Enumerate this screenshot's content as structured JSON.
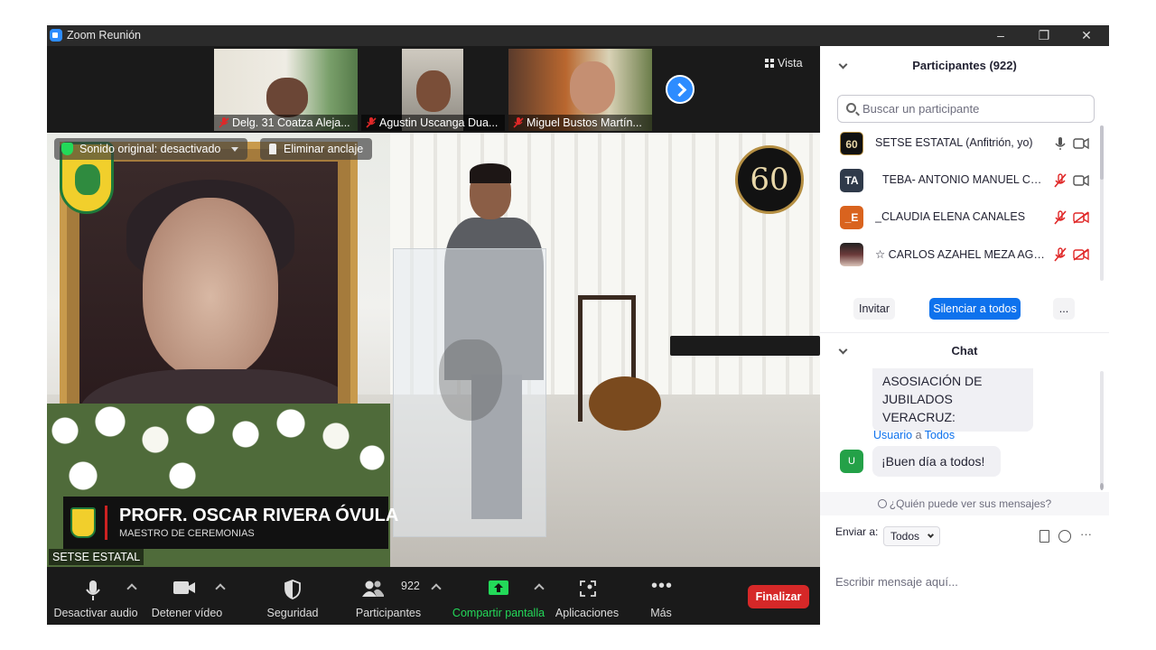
{
  "window": {
    "title": "Zoom Reunión",
    "minimize": "–",
    "restore": "❐",
    "close": "✕"
  },
  "thumbnails": [
    {
      "label": "Delg. 31 Coatza Aleja..."
    },
    {
      "label": "Agustin Uscanga Dua..."
    },
    {
      "label": "Miguel Bustos Martín..."
    }
  ],
  "view_label": "Vista",
  "main_video": {
    "audio_pill": "Sonido original: desactivado",
    "unpin": "Eliminar anclaje",
    "anniversary": "60",
    "lower_third_name": "PROFR. OSCAR RIVERA ÓVULA",
    "lower_third_role": "MAESTRO DE CEREMONIAS",
    "participant_label": "SETSE ESTATAL"
  },
  "toolbar": {
    "mute": "Desactivar audio",
    "video": "Detener vídeo",
    "security": "Seguridad",
    "participants": "Participantes",
    "participants_count": "922",
    "share": "Compartir pantalla",
    "apps": "Aplicaciones",
    "more": "Más",
    "end": "Finalizar"
  },
  "participants_panel": {
    "title": "Participantes (922)",
    "search_placeholder": "Buscar un participante",
    "items": [
      {
        "avatar": "60",
        "name": "SETSE ESTATAL (Anfitrión, yo)",
        "color": "#111111",
        "muted": false,
        "video_off": false
      },
      {
        "avatar": "TA",
        "name": "TEBA- ANTONIO MANUEL CO...",
        "color": "#2f3a4a",
        "muted": true,
        "video_off": false
      },
      {
        "avatar": "_E",
        "name": "_CLAUDIA ELENA CANALES",
        "color": "#d9631e",
        "muted": true,
        "video_off": true
      },
      {
        "avatar": "",
        "name": "☆ CARLOS AZAHEL MEZA AGU...",
        "color": "#3b2a2a",
        "muted": true,
        "video_off": true
      }
    ],
    "invite": "Invitar",
    "mute_all": "Silenciar a todos",
    "more": "..."
  },
  "chat_panel": {
    "title": "Chat",
    "prev_message": "ASOSIACIÓN DE JUBILADOS VERACRUZ:",
    "sender": "Usuario",
    "sender_to": "a",
    "recipient": "Todos",
    "avatar": "U",
    "message": "¡Buen día a todos!",
    "who_can_see": "¿Quién puede ver sus mensajes?",
    "send_to_label": "Enviar a:",
    "send_to_value": "Todos",
    "input_placeholder": "Escribir mensaje aquí...",
    "more": "···"
  },
  "colors": {
    "accent": "#2d8cff",
    "end_button": "#d62828",
    "share_green": "#23d959",
    "muted_red": "#e02828"
  }
}
